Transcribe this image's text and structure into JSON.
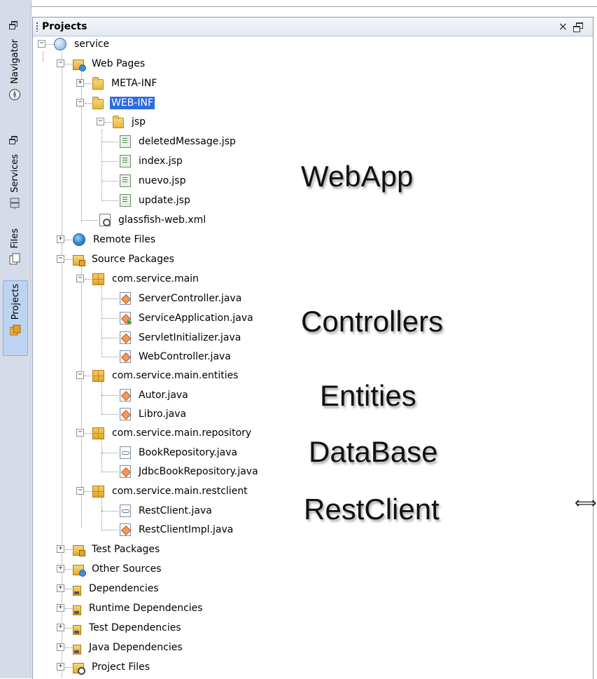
{
  "side_tabs": [
    {
      "label": "Navigator",
      "icon": "compass-icon",
      "active": false
    },
    {
      "label": "Services",
      "icon": "server-icon",
      "active": false
    },
    {
      "label": "Files",
      "icon": "files-icon",
      "active": false
    },
    {
      "label": "Projects",
      "icon": "projects-icon",
      "active": true
    }
  ],
  "panel": {
    "title": "Projects",
    "close_glyph": "×"
  },
  "tree": {
    "root": "service",
    "web_pages": "Web Pages",
    "meta_inf": "META-INF",
    "web_inf": "WEB-INF",
    "jsp": "jsp",
    "jsp_files": [
      "deletedMessage.jsp",
      "index.jsp",
      "nuevo.jsp",
      "update.jsp"
    ],
    "glassfish": "glassfish-web.xml",
    "remote_files": "Remote Files",
    "source_packages": "Source Packages",
    "pkg_main": "com.service.main",
    "main_files": [
      "ServerController.java",
      "ServiceApplication.java",
      "ServletInitializer.java",
      "WebController.java"
    ],
    "pkg_entities": "com.service.main.entities",
    "entity_files": [
      "Autor.java",
      "Libro.java"
    ],
    "pkg_repository": "com.service.main.repository",
    "repository_files": [
      "BookRepository.java",
      "JdbcBookRepository.java"
    ],
    "pkg_restclient": "com.service.main.restclient",
    "restclient_files": [
      "RestClient.java",
      "RestClientImpl.java"
    ],
    "test_packages": "Test Packages",
    "other_sources": "Other Sources",
    "dependencies": "Dependencies",
    "runtime_dependencies": "Runtime Dependencies",
    "test_dependencies": "Test Dependencies",
    "java_dependencies": "Java Dependencies",
    "project_files": "Project Files",
    "selected": "WEB-INF"
  },
  "annotations": {
    "webapp": "WebApp",
    "controllers": "Controllers",
    "entities": "Entities",
    "database": "DataBase",
    "restclient": "RestClient"
  },
  "colors": {
    "selection": "#2d6be0",
    "strip": "#d6dbe9",
    "active_tab": "#bcd4f1"
  }
}
